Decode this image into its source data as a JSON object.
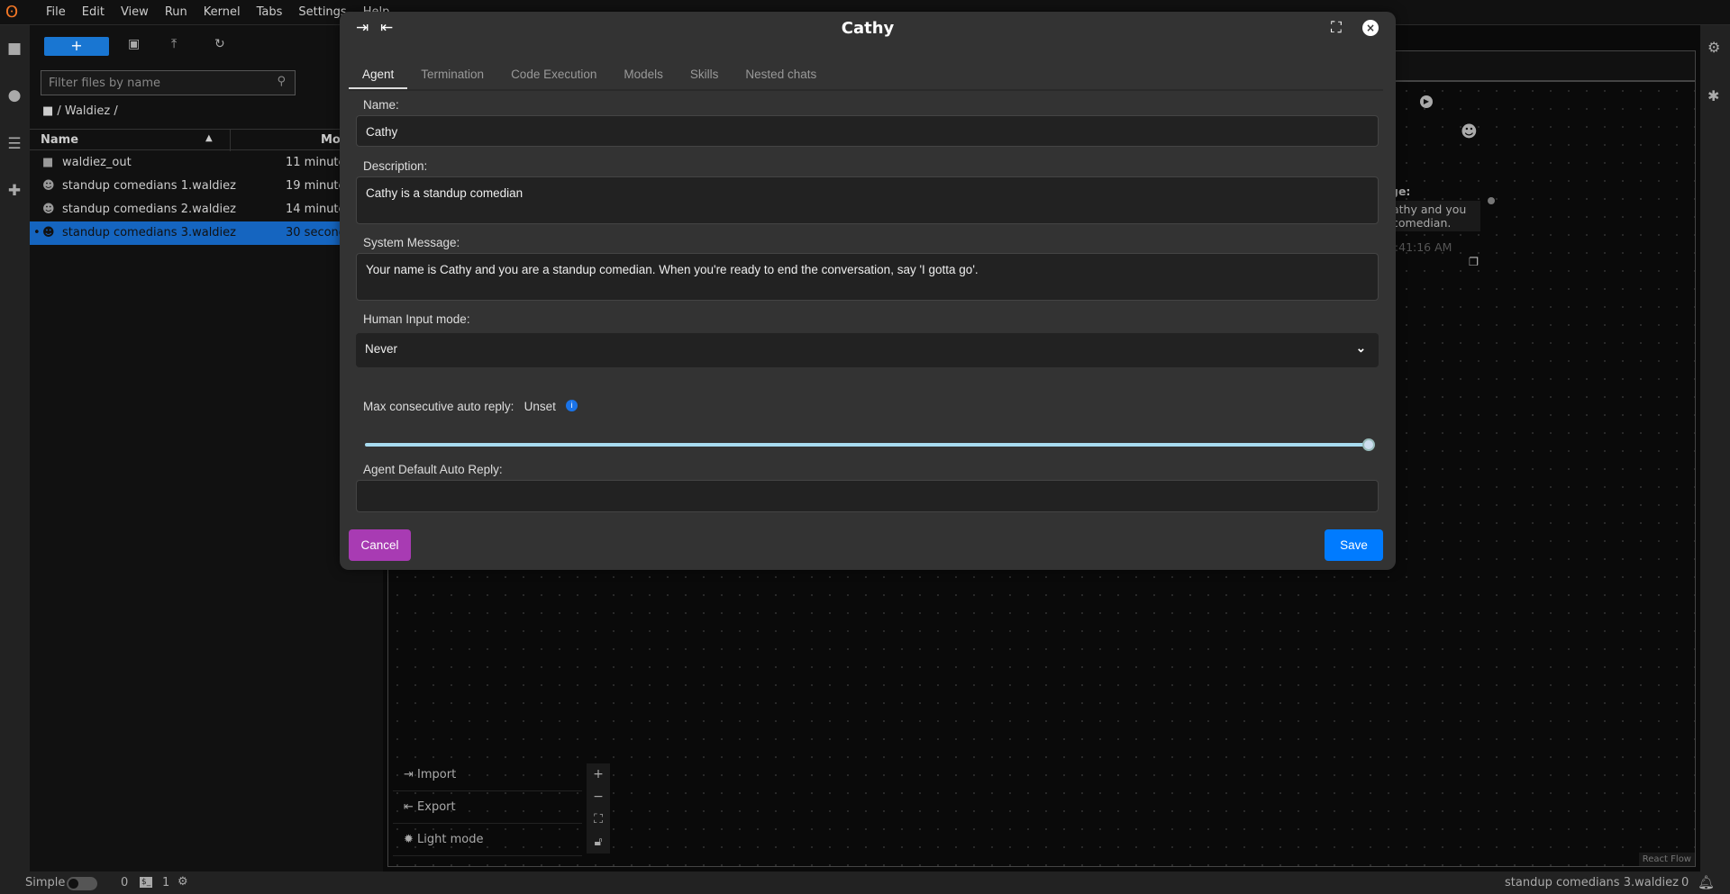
{
  "menubar": {
    "items": [
      "File",
      "Edit",
      "View",
      "Run",
      "Kernel",
      "Tabs",
      "Settings",
      "Help"
    ]
  },
  "filebrowser": {
    "filter_placeholder": "Filter files by name",
    "breadcrumb": "/ Waldiez /",
    "columns": {
      "name": "Name",
      "modified": "Mo"
    },
    "rows": [
      {
        "name": "waldiez_out",
        "modified": "11 minute",
        "icon": "folder-icon"
      },
      {
        "name": "standup comedians 1.waldiez",
        "modified": "19 minute",
        "icon": "waldiez-file-icon"
      },
      {
        "name": "standup comedians 2.waldiez",
        "modified": "14 minute",
        "icon": "waldiez-file-icon"
      },
      {
        "name": "standup comedians 3.waldiez",
        "modified": "30 second",
        "icon": "waldiez-file-icon",
        "selected": true
      }
    ]
  },
  "canvas": {
    "side_items": [
      "Import",
      "Export",
      "Light mode"
    ],
    "node": {
      "label": "ge:",
      "text": "athy and you\ncomedian.",
      "time": "10:41:16 AM"
    },
    "attribution": "React Flow"
  },
  "dialog": {
    "title": "Cathy",
    "tabs": [
      "Agent",
      "Termination",
      "Code Execution",
      "Models",
      "Skills",
      "Nested chats"
    ],
    "active_tab": "Agent",
    "name_label": "Name:",
    "name_value": "Cathy",
    "description_label": "Description:",
    "description_value": "Cathy is a standup comedian",
    "system_label": "System Message:",
    "system_value": "Your name is Cathy and you are a standup comedian. When you're ready to end the conversation, say 'I gotta go'.",
    "human_input_label": "Human Input mode:",
    "human_input_value": "Never",
    "max_reply_label": "Max consecutive auto reply:",
    "max_reply_value": "Unset",
    "slider_fraction": 1.0,
    "default_reply_label": "Agent Default Auto Reply:",
    "default_reply_value": "",
    "cancel": "Cancel",
    "save": "Save",
    "colors": {
      "cancel": "#a83bb3",
      "save": "#007bff",
      "slider": "#a8dcf0"
    }
  },
  "statusbar": {
    "mode": "Simple",
    "kernels": "0",
    "terminals": "1",
    "filename": "standup comedians 3.waldiez",
    "notifications": "0"
  }
}
